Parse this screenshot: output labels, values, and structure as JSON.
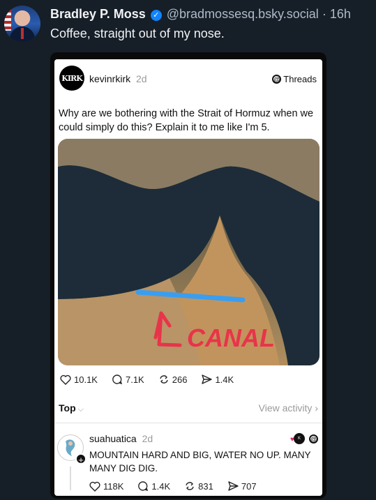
{
  "post": {
    "author": "Bradley P. Moss",
    "handle": "@bradmossesq.bsky.social",
    "separator": "·",
    "time": "16h",
    "text": "Coffee, straight out of my nose."
  },
  "embed": {
    "username": "kevinrkirk",
    "age": "2d",
    "platform": "Threads",
    "avatar_text": "KIRK",
    "body": "Why are we bothering with the Strait of Hormuz when we could simply do this? Explain it to me like I'm 5.",
    "image_label": "CANAL",
    "stats": {
      "likes": "10.1K",
      "replies": "7.1K",
      "reposts": "266",
      "shares": "1.4K"
    },
    "sort_label": "Top",
    "view_activity": "View activity"
  },
  "reply": {
    "username": "suahuatica",
    "age": "2d",
    "body": "MOUNTAIN HARD AND BIG, WATER NO UP. MANY MANY DIG DIG.",
    "plus": "+",
    "stats": {
      "likes": "118K",
      "replies": "1.4K",
      "reposts": "831",
      "shares": "707"
    }
  },
  "colors": {
    "background": "#161e27",
    "verified": "#1083fe",
    "canal_line": "#3a9ef0",
    "canal_text": "#e8344a"
  },
  "icons": [
    "verified-badge-icon",
    "threads-icon",
    "heart-icon",
    "comment-icon",
    "repost-icon",
    "share-icon",
    "chevron-down-icon",
    "chevron-right-icon"
  ]
}
